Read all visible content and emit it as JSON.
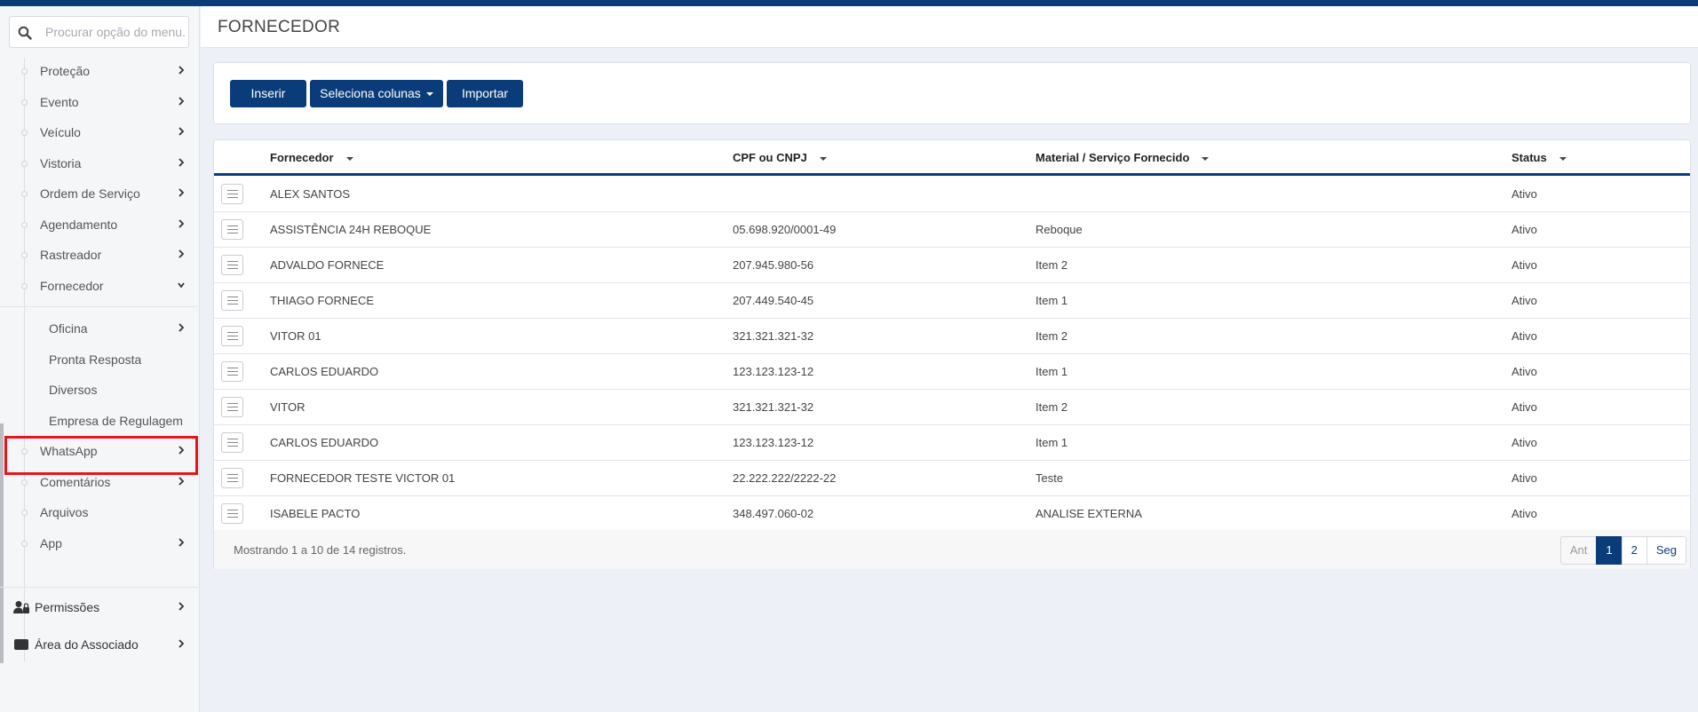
{
  "search": {
    "placeholder": "Procurar opção do menu..."
  },
  "sidebar": {
    "items": [
      {
        "label": "Proteção",
        "has_arrow": true
      },
      {
        "label": "Evento",
        "has_arrow": true
      },
      {
        "label": "Veículo",
        "has_arrow": true
      },
      {
        "label": "Vistoria",
        "has_arrow": true
      },
      {
        "label": "Ordem de Serviço",
        "has_arrow": true
      },
      {
        "label": "Agendamento",
        "has_arrow": true
      },
      {
        "label": "Rastreador",
        "has_arrow": true
      },
      {
        "label": "Fornecedor",
        "expanded": true
      }
    ],
    "sub_items": [
      {
        "label": "Oficina",
        "has_arrow": true
      },
      {
        "label": "Pronta Resposta"
      },
      {
        "label": "Diversos",
        "highlighted": true
      },
      {
        "label": "Empresa de Regulagem"
      }
    ],
    "items_after": [
      {
        "label": "WhatsApp",
        "has_arrow": true
      },
      {
        "label": "Comentários",
        "has_arrow": true
      },
      {
        "label": "Arquivos"
      },
      {
        "label": "App",
        "has_arrow": true
      }
    ],
    "bottom": [
      {
        "label": "Permissões",
        "icon": "user-lock-icon"
      },
      {
        "label": "Área do Associado",
        "icon": "id-card-icon"
      }
    ]
  },
  "header": {
    "title": "FORNECEDOR"
  },
  "toolbar": {
    "insert_label": "Inserir",
    "columns_label": "Seleciona colunas",
    "import_label": "Importar"
  },
  "table": {
    "columns": [
      "Fornecedor",
      "CPF ou CNPJ",
      "Material / Serviço Fornecido",
      "Status"
    ],
    "rows": [
      [
        "ALEX SANTOS",
        "",
        "",
        "Ativo"
      ],
      [
        "ASSISTÊNCIA 24H REBOQUE",
        "05.698.920/0001-49",
        "Reboque",
        "Ativo"
      ],
      [
        "ADVALDO FORNECE",
        "207.945.980-56",
        "Item 2",
        "Ativo"
      ],
      [
        "THIAGO FORNECE",
        "207.449.540-45",
        "Item 1",
        "Ativo"
      ],
      [
        "VITOR 01",
        "321.321.321-32",
        "Item 2",
        "Ativo"
      ],
      [
        "CARLOS EDUARDO",
        "123.123.123-12",
        "Item 1",
        "Ativo"
      ],
      [
        "VITOR",
        "321.321.321-32",
        "Item 2",
        "Ativo"
      ],
      [
        "CARLOS EDUARDO",
        "123.123.123-12",
        "Item 1",
        "Ativo"
      ],
      [
        "FORNECEDOR TESTE VICTOR 01",
        "22.222.222/2222-22",
        "Teste",
        "Ativo"
      ],
      [
        "ISABELE PACTO",
        "348.497.060-02",
        "ANALISE EXTERNA",
        "Ativo"
      ]
    ],
    "footer_info": "Mostrando 1 a 10 de 14 registros."
  },
  "pagination": {
    "prev": "Ant",
    "pages": [
      "1",
      "2"
    ],
    "current": "1",
    "next": "Seg"
  },
  "colors": {
    "primary": "#0b3c7a",
    "highlight": "#e8141b",
    "background": "#eef0f7"
  }
}
